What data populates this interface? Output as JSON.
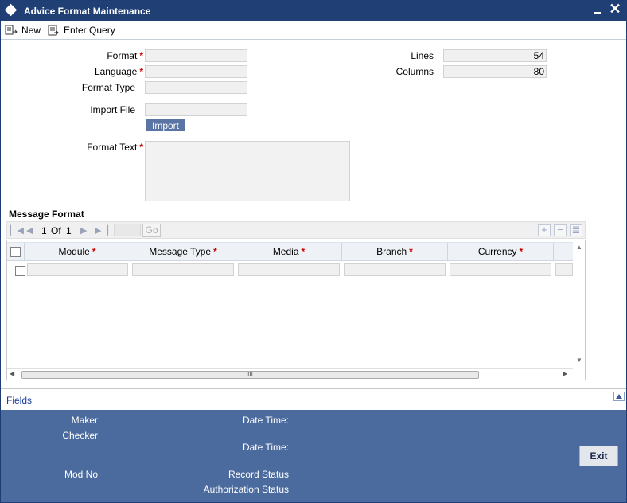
{
  "window": {
    "title": "Advice Format Maintenance",
    "minimize_glyph": "▬",
    "close_glyph": "✕"
  },
  "toolbar": {
    "new_label": "New",
    "enter_query_label": "Enter Query"
  },
  "form": {
    "format_label": "Format",
    "language_label": "Language",
    "format_type_label": "Format Type",
    "import_file_label": "Import File",
    "import_button": "Import",
    "format_text_label": "Format Text",
    "required_mark": "*",
    "lines_label": "Lines",
    "lines_value": "54",
    "columns_label": "Columns",
    "columns_value": "80",
    "format_value": "",
    "language_value": "",
    "format_type_value": "",
    "import_file_value": "",
    "format_text_value": ""
  },
  "message_format": {
    "section_title": "Message Format",
    "pager": {
      "current": "1",
      "of_label": "Of",
      "total": "1",
      "go_label": "Go"
    },
    "columns": [
      {
        "label": "Module"
      },
      {
        "label": "Message Type"
      },
      {
        "label": "Media"
      },
      {
        "label": "Branch"
      },
      {
        "label": "Currency"
      }
    ],
    "hscroll_grip": "III"
  },
  "fields_link": "Fields",
  "footer": {
    "maker_label": "Maker",
    "checker_label": "Checker",
    "date_time_label_1": "Date Time:",
    "date_time_label_2": "Date Time:",
    "mod_no_label": "Mod No",
    "record_status_label": "Record Status",
    "authorization_status_label": "Authorization Status",
    "exit_button": "Exit"
  },
  "colors": {
    "title_bar": "#1f3f75",
    "footer": "#4b6a9e",
    "import_button": "#5a74a4",
    "required": "#cc0000"
  },
  "icons": [
    "new-icon",
    "enter-query-icon",
    "first-page-icon",
    "prev-page-icon",
    "next-page-icon",
    "last-page-icon",
    "add-row-icon",
    "delete-row-icon",
    "single-view-icon",
    "scroll-up-icon",
    "scroll-down-icon",
    "scroll-left-icon",
    "scroll-right-icon",
    "collapse-up-icon"
  ]
}
